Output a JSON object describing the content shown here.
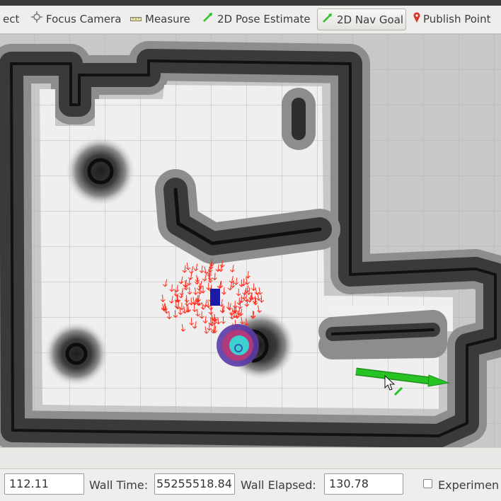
{
  "toolbar": {
    "tools": [
      {
        "label": "ect",
        "icon": "select-icon"
      },
      {
        "label": "Focus Camera",
        "icon": "focus-camera-icon"
      },
      {
        "label": "Measure",
        "icon": "ruler-icon"
      },
      {
        "label": "2D Pose Estimate",
        "icon": "pose-arrow-icon"
      },
      {
        "label": "2D Nav Goal",
        "icon": "nav-goal-arrow-icon",
        "active": true
      },
      {
        "label": "Publish Point",
        "icon": "map-pin-icon"
      }
    ]
  },
  "viewport": {
    "robot_color": "#1a1aa6",
    "particle_color": "#ff2a1a",
    "goal_arrow_color": "#22c21f",
    "costmap_color": "#3a3a3a"
  },
  "time": {
    "sim_time_value": "112.11",
    "wall_time_label": "Wall Time:",
    "wall_time_value": "55255518.84",
    "wall_elapsed_label": "Wall Elapsed:",
    "wall_elapsed_value": "130.78",
    "experimental_label": "Experimen"
  }
}
